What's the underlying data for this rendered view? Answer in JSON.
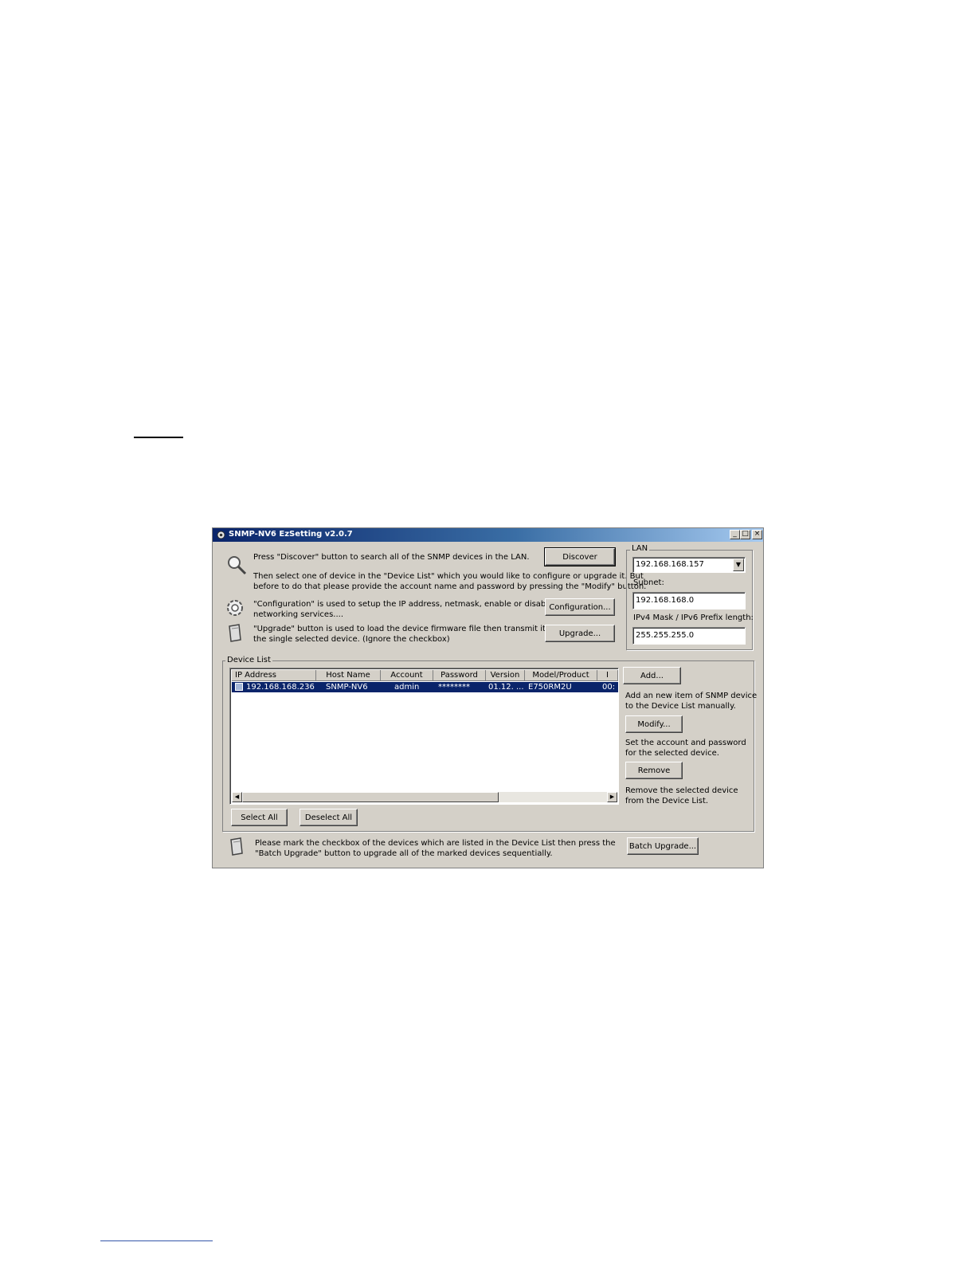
{
  "window": {
    "title": "SNMP-NV6 EzSetting v2.0.7",
    "controls": {
      "minimize": "_",
      "maximize": "□",
      "close": "×"
    }
  },
  "top_section": {
    "discover_text": "Press \"Discover\" button to search all of the SNMP devices in the LAN.",
    "select_text_1": "Then select one of device in the \"Device List\" which you would like to configure or upgrade it. But",
    "select_text_2": "before to do that please provide the account name and password by pressing the \"Modify\" button.",
    "config_text_1": "\"Configuration\" is used to setup the IP address, netmask, enable or disable",
    "config_text_2": "networking services....",
    "upgrade_text_1": "\"Upgrade\" button is used to load the device firmware file then transmit it to",
    "upgrade_text_2": "the single selected device. (Ignore the checkbox)",
    "discover_button": "Discover",
    "configuration_button": "Configuration...",
    "upgrade_button": "Upgrade..."
  },
  "lan": {
    "group_label": "LAN",
    "lan_value": "192.168.168.157",
    "subnet_label": "Subnet:",
    "subnet_value": "192.168.168.0",
    "mask_label": "IPv4 Mask / IPv6 Prefix length:",
    "mask_value": "255.255.255.0"
  },
  "device_list": {
    "group_label": "Device List",
    "columns": [
      "IP Address",
      "Host Name",
      "Account",
      "Password",
      "Version",
      "Model/Product",
      "I"
    ],
    "rows": [
      {
        "ip": "192.168.168.236",
        "host": "SNMP-NV6",
        "account": "admin",
        "password": "********",
        "version": "01.12. ...",
        "model": "E750RM2U",
        "extra": "00:"
      }
    ],
    "select_all_button": "Select All",
    "deselect_all_button": "Deselect All",
    "add_button": "Add...",
    "add_text_1": "Add an new item of SNMP device",
    "add_text_2": "to the Device List manually.",
    "modify_button": "Modify...",
    "modify_text_1": "Set the account and password",
    "modify_text_2": "for the selected device.",
    "remove_button": "Remove",
    "remove_text_1": "Remove the selected device",
    "remove_text_2": "from the Device List."
  },
  "batch": {
    "text_1": "Please mark the checkbox of the devices which are listed in the Device List then press the",
    "text_2": "\"Batch Upgrade\" button to upgrade all of the marked devices sequentially.",
    "button": "Batch Upgrade..."
  }
}
